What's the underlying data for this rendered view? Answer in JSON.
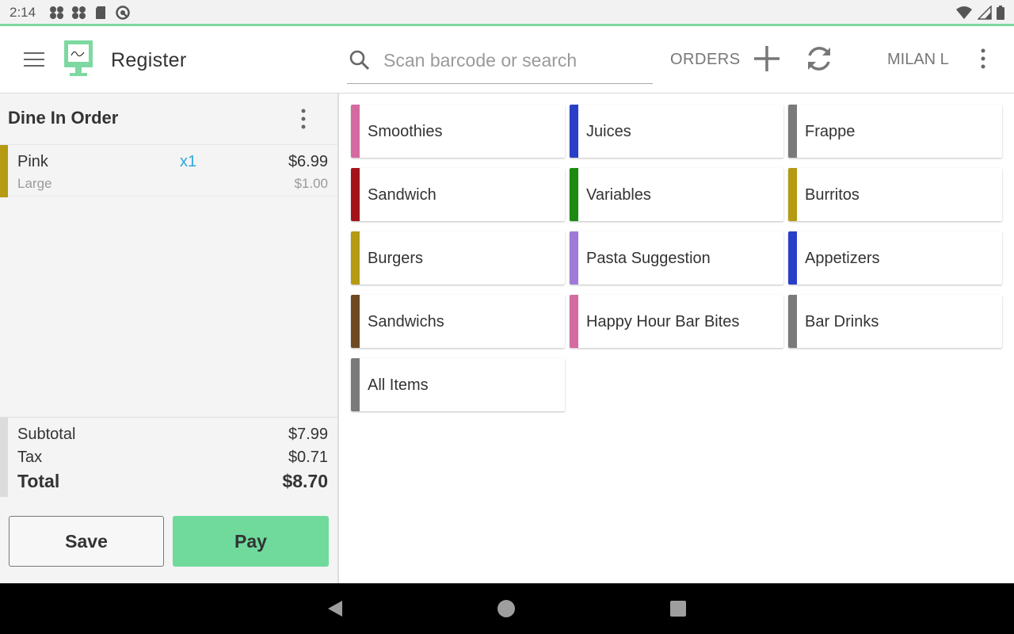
{
  "status_bar": {
    "time": "2:14",
    "left_icons": [
      "pinwheel-icon",
      "pinwheel-icon",
      "sd-card-icon",
      "vpn-key-icon"
    ],
    "right_icons": [
      "wifi-icon",
      "cell-signal-icon",
      "battery-icon"
    ]
  },
  "app_bar": {
    "title": "Register",
    "search_placeholder": "Scan barcode or search",
    "orders_label": "ORDERS",
    "user_label": "MILAN L"
  },
  "order": {
    "title": "Dine In Order",
    "items": [
      {
        "name": "Pink",
        "modifier": "Large",
        "quantity": "x1",
        "price": "$6.99",
        "modifier_price": "$1.00",
        "color": "#b59a12"
      }
    ],
    "subtotal_label": "Subtotal",
    "subtotal": "$7.99",
    "tax_label": "Tax",
    "tax": "$0.71",
    "total_label": "Total",
    "total": "$8.70"
  },
  "actions": {
    "save_label": "Save",
    "pay_label": "Pay"
  },
  "categories": [
    {
      "label": "Smoothies",
      "color": "#d56aa1"
    },
    {
      "label": "Juices",
      "color": "#2a3fc8"
    },
    {
      "label": "Frappe",
      "color": "#7a7a7a"
    },
    {
      "label": "Sandwich",
      "color": "#a3141a"
    },
    {
      "label": "Variables",
      "color": "#1c8a10"
    },
    {
      "label": "Burritos",
      "color": "#b59a12"
    },
    {
      "label": "Burgers",
      "color": "#b59a12"
    },
    {
      "label": "Pasta Suggestion",
      "color": "#a07ad8"
    },
    {
      "label": "Appetizers",
      "color": "#2a3fc8"
    },
    {
      "label": "Sandwichs",
      "color": "#6e4a22"
    },
    {
      "label": "Happy Hour Bar Bites",
      "color": "#d56aa1"
    },
    {
      "label": "Bar Drinks",
      "color": "#7a7a7a"
    },
    {
      "label": "All Items",
      "color": "#7a7a7a"
    }
  ],
  "colors": {
    "accent": "#6fda9c",
    "quantity": "#2ea8e0"
  }
}
